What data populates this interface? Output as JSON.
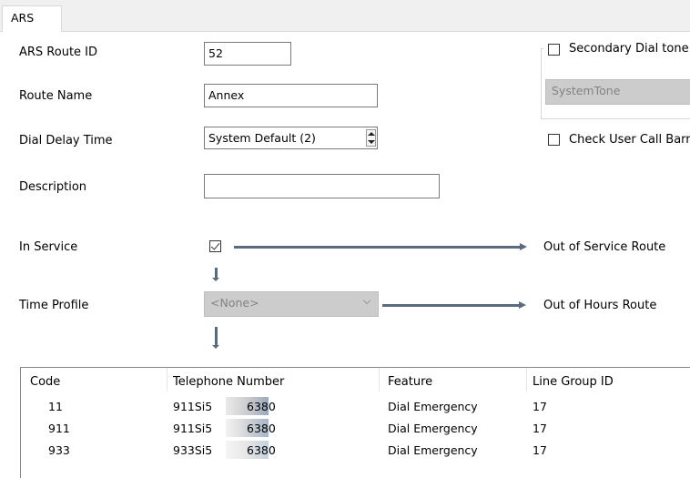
{
  "tabs": [
    {
      "label": "ARS"
    }
  ],
  "form": {
    "ars_route_id": {
      "label": "ARS Route ID",
      "value": "52"
    },
    "route_name": {
      "label": "Route Name",
      "value": "Annex"
    },
    "dial_delay_time": {
      "label": "Dial Delay Time",
      "value": "System Default (2)"
    },
    "description": {
      "label": "Description",
      "value": ""
    },
    "in_service": {
      "label": "In Service",
      "checked": true
    },
    "time_profile": {
      "label": "Time Profile",
      "value": "<None>"
    }
  },
  "secondary_dial_tone": {
    "label": "Secondary Dial tone",
    "checked": false,
    "tone_value": "SystemTone"
  },
  "check_user_call_barring": {
    "label": "Check User Call Barr",
    "checked": false
  },
  "routes": {
    "out_of_service": "Out of Service Route",
    "out_of_hours": "Out of Hours Route"
  },
  "table": {
    "columns": [
      "Code",
      "Telephone Number",
      "Feature",
      "Line Group ID"
    ],
    "rows": [
      {
        "code": "11",
        "tel_prefix": "911Si5",
        "tel_suffix": "6380",
        "feature": "Dial Emergency",
        "line_group": "17"
      },
      {
        "code": "911",
        "tel_prefix": "911Si5",
        "tel_suffix": "6380",
        "feature": "Dial Emergency",
        "line_group": "17"
      },
      {
        "code": "933",
        "tel_prefix": "933Si5",
        "tel_suffix": "6380",
        "feature": "Dial Emergency",
        "line_group": "17"
      }
    ]
  },
  "colors": {
    "arrow": "#5a6b80",
    "disabled_fill": "#cccccc",
    "list_border": "#828790"
  }
}
